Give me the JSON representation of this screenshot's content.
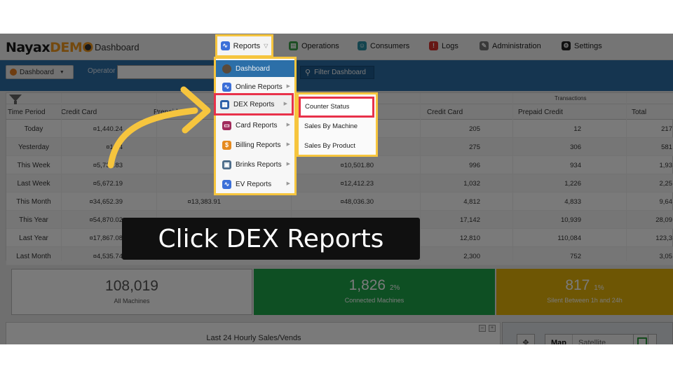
{
  "colors": {
    "accent_yellow": "#f6c53e",
    "highlight_red": "#e8314a",
    "filter_bar_blue": "#2c6fa8",
    "connected_green": "#1ea64a",
    "silent_amber": "#e7b409"
  },
  "topnav": {
    "brand_main": "Nayax",
    "brand_demo": "DEMO",
    "breadcrumb": "Dashboard",
    "items": [
      {
        "label": "Reports",
        "icon": "chart-line-icon"
      },
      {
        "label": "Operations",
        "icon": "document-icon"
      },
      {
        "label": "Consumers",
        "icon": "users-icon"
      },
      {
        "label": "Logs",
        "icon": "alert-icon"
      },
      {
        "label": "Administration",
        "icon": "edit-icon"
      },
      {
        "label": "Settings",
        "icon": "gear-icon"
      }
    ]
  },
  "filterbar": {
    "dashboard_select": "Dashboard",
    "operator_label": "Operator",
    "filter_button": "Filter Dashboard"
  },
  "reports_menu": {
    "items": [
      {
        "label": "Dashboard",
        "icon": "dashboard-icon"
      },
      {
        "label": "Online Reports",
        "icon": "chart-line-icon"
      },
      {
        "label": "DEX Reports",
        "icon": "file-icon"
      },
      {
        "label": "Card Reports",
        "icon": "card-icon"
      },
      {
        "label": "Billing Reports",
        "icon": "billing-icon"
      },
      {
        "label": "Brinks Reports",
        "icon": "brinks-icon"
      },
      {
        "label": "EV Reports",
        "icon": "chart-line-icon"
      }
    ],
    "dex_submenu": [
      "Counter Status",
      "Sales By Machine",
      "Sales By Product"
    ]
  },
  "table": {
    "group_header_transactions": "Transactions",
    "headers": {
      "time_period": "Time Period",
      "credit_card": "Credit Card",
      "prepaid_credit": "Prepaid Cr",
      "t_credit_card": "Credit Card",
      "t_prepaid_credit": "Prepaid Credit",
      "t_total": "Total"
    },
    "rows": [
      {
        "period": "Today",
        "cc": "¤1,440.24",
        "pp": "",
        "tot": "",
        "tcc": "205",
        "tpp": "12",
        "ttot": "217"
      },
      {
        "period": "Yesterday",
        "cc": "¤1,34",
        "pp": "¤",
        "tot": "",
        "tcc": "275",
        "tpp": "306",
        "ttot": "581"
      },
      {
        "period": "This Week",
        "cc": "¤5,737.83",
        "pp": "¤",
        "tot": "¤10,501.80",
        "tcc": "996",
        "tpp": "934",
        "ttot": "1,93"
      },
      {
        "period": "Last Week",
        "cc": "¤5,672.19",
        "pp": "¤",
        "tot": "¤12,412.23",
        "tcc": "1,032",
        "tpp": "1,226",
        "ttot": "2,25"
      },
      {
        "period": "This Month",
        "cc": "¤34,652.39",
        "pp": "¤13,383.91",
        "tot": "¤48,036.30",
        "tcc": "4,812",
        "tpp": "4,833",
        "ttot": "9,64"
      },
      {
        "period": "This Year",
        "cc": "¤54,870.02",
        "pp": "",
        "tot": "",
        "tcc": "17,142",
        "tpp": "10,939",
        "ttot": "28,09"
      },
      {
        "period": "Last Year",
        "cc": "¤17,867.08",
        "pp": "",
        "tot": "",
        "tcc": "12,810",
        "tpp": "110,084",
        "ttot": "123,3"
      },
      {
        "period": "Last Month",
        "cc": "¤4,535.74",
        "pp": "",
        "tot": "",
        "tcc": "2,300",
        "tpp": "752",
        "ttot": "3,05"
      }
    ]
  },
  "stats": {
    "all_machines": {
      "value": "108,019",
      "label": "All Machines"
    },
    "connected": {
      "value": "1,826",
      "pct": "2%",
      "label": "Connected Machines"
    },
    "silent": {
      "value": "817",
      "pct": "1%",
      "label": "Silent Between 1h and 24h"
    }
  },
  "bottom": {
    "hourly_title": "Last 24 Hourly Sales/Vends",
    "map_tab": "Map",
    "satellite_tab": "Satellite"
  },
  "caption": "Click DEX Reports"
}
